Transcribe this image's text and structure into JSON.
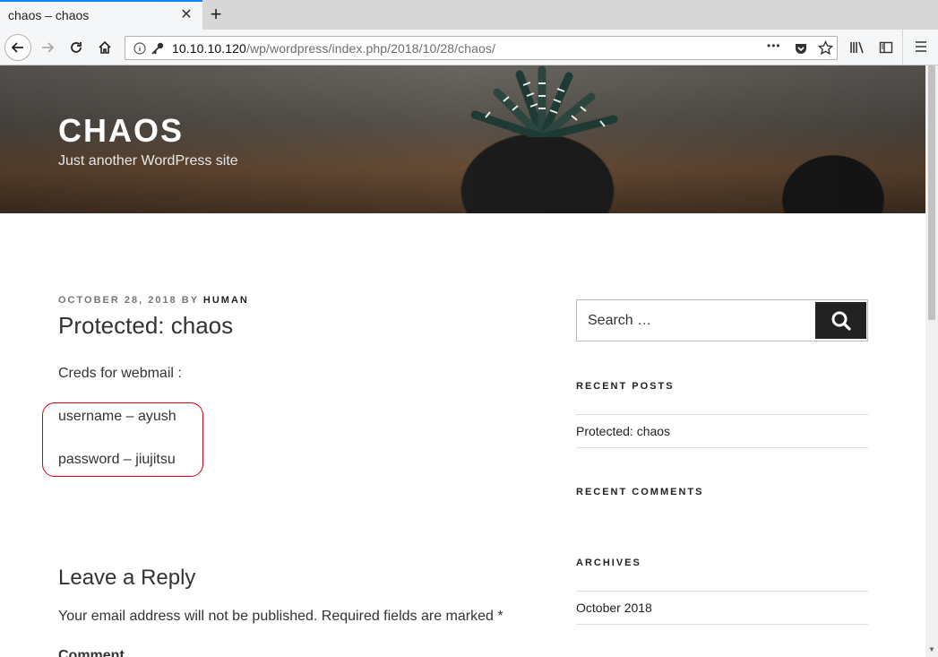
{
  "browser": {
    "tab_title": "chaos – chaos",
    "tab_close": "✕",
    "new_tab": "+",
    "url_host": "10.10.10.120",
    "url_path": "/wp/wordpress/index.php/2018/10/28/chaos/",
    "url_more": "•••"
  },
  "site": {
    "title": "CHAOS",
    "description": "Just another WordPress site"
  },
  "post": {
    "date": "OCTOBER 28, 2018",
    "by": "BY",
    "author": "HUMAN",
    "title": "Protected: chaos",
    "paragraphs": [
      "Creds for webmail :",
      "username – ayush",
      "password – jiujitsu"
    ]
  },
  "reply": {
    "title": "Leave a Reply",
    "note": "Your email address will not be published. Required fields are marked *",
    "comment_label": "Comment"
  },
  "sidebar": {
    "search_placeholder": "Search …",
    "recent_posts_title": "RECENT POSTS",
    "recent_posts": [
      "Protected: chaos"
    ],
    "recent_comments_title": "RECENT COMMENTS",
    "archives_title": "ARCHIVES",
    "archives": [
      "October 2018"
    ]
  },
  "colors": {
    "highlight": "#d8000c",
    "tab_accent": "#0a84ff"
  }
}
